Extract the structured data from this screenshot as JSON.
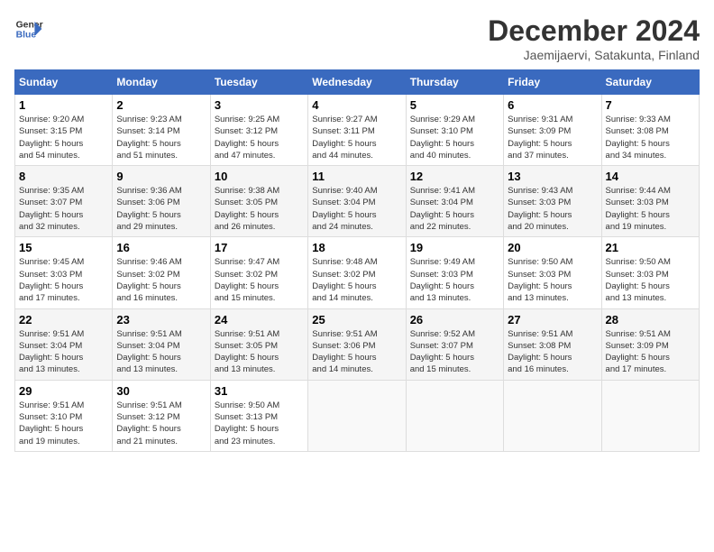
{
  "header": {
    "logo_line1": "General",
    "logo_line2": "Blue",
    "title": "December 2024",
    "subtitle": "Jaemijaervi, Satakunta, Finland"
  },
  "columns": [
    "Sunday",
    "Monday",
    "Tuesday",
    "Wednesday",
    "Thursday",
    "Friday",
    "Saturday"
  ],
  "weeks": [
    [
      {
        "day": "1",
        "info": "Sunrise: 9:20 AM\nSunset: 3:15 PM\nDaylight: 5 hours\nand 54 minutes."
      },
      {
        "day": "2",
        "info": "Sunrise: 9:23 AM\nSunset: 3:14 PM\nDaylight: 5 hours\nand 51 minutes."
      },
      {
        "day": "3",
        "info": "Sunrise: 9:25 AM\nSunset: 3:12 PM\nDaylight: 5 hours\nand 47 minutes."
      },
      {
        "day": "4",
        "info": "Sunrise: 9:27 AM\nSunset: 3:11 PM\nDaylight: 5 hours\nand 44 minutes."
      },
      {
        "day": "5",
        "info": "Sunrise: 9:29 AM\nSunset: 3:10 PM\nDaylight: 5 hours\nand 40 minutes."
      },
      {
        "day": "6",
        "info": "Sunrise: 9:31 AM\nSunset: 3:09 PM\nDaylight: 5 hours\nand 37 minutes."
      },
      {
        "day": "7",
        "info": "Sunrise: 9:33 AM\nSunset: 3:08 PM\nDaylight: 5 hours\nand 34 minutes."
      }
    ],
    [
      {
        "day": "8",
        "info": "Sunrise: 9:35 AM\nSunset: 3:07 PM\nDaylight: 5 hours\nand 32 minutes."
      },
      {
        "day": "9",
        "info": "Sunrise: 9:36 AM\nSunset: 3:06 PM\nDaylight: 5 hours\nand 29 minutes."
      },
      {
        "day": "10",
        "info": "Sunrise: 9:38 AM\nSunset: 3:05 PM\nDaylight: 5 hours\nand 26 minutes."
      },
      {
        "day": "11",
        "info": "Sunrise: 9:40 AM\nSunset: 3:04 PM\nDaylight: 5 hours\nand 24 minutes."
      },
      {
        "day": "12",
        "info": "Sunrise: 9:41 AM\nSunset: 3:04 PM\nDaylight: 5 hours\nand 22 minutes."
      },
      {
        "day": "13",
        "info": "Sunrise: 9:43 AM\nSunset: 3:03 PM\nDaylight: 5 hours\nand 20 minutes."
      },
      {
        "day": "14",
        "info": "Sunrise: 9:44 AM\nSunset: 3:03 PM\nDaylight: 5 hours\nand 19 minutes."
      }
    ],
    [
      {
        "day": "15",
        "info": "Sunrise: 9:45 AM\nSunset: 3:03 PM\nDaylight: 5 hours\nand 17 minutes."
      },
      {
        "day": "16",
        "info": "Sunrise: 9:46 AM\nSunset: 3:02 PM\nDaylight: 5 hours\nand 16 minutes."
      },
      {
        "day": "17",
        "info": "Sunrise: 9:47 AM\nSunset: 3:02 PM\nDaylight: 5 hours\nand 15 minutes."
      },
      {
        "day": "18",
        "info": "Sunrise: 9:48 AM\nSunset: 3:02 PM\nDaylight: 5 hours\nand 14 minutes."
      },
      {
        "day": "19",
        "info": "Sunrise: 9:49 AM\nSunset: 3:03 PM\nDaylight: 5 hours\nand 13 minutes."
      },
      {
        "day": "20",
        "info": "Sunrise: 9:50 AM\nSunset: 3:03 PM\nDaylight: 5 hours\nand 13 minutes."
      },
      {
        "day": "21",
        "info": "Sunrise: 9:50 AM\nSunset: 3:03 PM\nDaylight: 5 hours\nand 13 minutes."
      }
    ],
    [
      {
        "day": "22",
        "info": "Sunrise: 9:51 AM\nSunset: 3:04 PM\nDaylight: 5 hours\nand 13 minutes."
      },
      {
        "day": "23",
        "info": "Sunrise: 9:51 AM\nSunset: 3:04 PM\nDaylight: 5 hours\nand 13 minutes."
      },
      {
        "day": "24",
        "info": "Sunrise: 9:51 AM\nSunset: 3:05 PM\nDaylight: 5 hours\nand 13 minutes."
      },
      {
        "day": "25",
        "info": "Sunrise: 9:51 AM\nSunset: 3:06 PM\nDaylight: 5 hours\nand 14 minutes."
      },
      {
        "day": "26",
        "info": "Sunrise: 9:52 AM\nSunset: 3:07 PM\nDaylight: 5 hours\nand 15 minutes."
      },
      {
        "day": "27",
        "info": "Sunrise: 9:51 AM\nSunset: 3:08 PM\nDaylight: 5 hours\nand 16 minutes."
      },
      {
        "day": "28",
        "info": "Sunrise: 9:51 AM\nSunset: 3:09 PM\nDaylight: 5 hours\nand 17 minutes."
      }
    ],
    [
      {
        "day": "29",
        "info": "Sunrise: 9:51 AM\nSunset: 3:10 PM\nDaylight: 5 hours\nand 19 minutes."
      },
      {
        "day": "30",
        "info": "Sunrise: 9:51 AM\nSunset: 3:12 PM\nDaylight: 5 hours\nand 21 minutes."
      },
      {
        "day": "31",
        "info": "Sunrise: 9:50 AM\nSunset: 3:13 PM\nDaylight: 5 hours\nand 23 minutes."
      },
      {
        "day": "",
        "info": ""
      },
      {
        "day": "",
        "info": ""
      },
      {
        "day": "",
        "info": ""
      },
      {
        "day": "",
        "info": ""
      }
    ]
  ]
}
